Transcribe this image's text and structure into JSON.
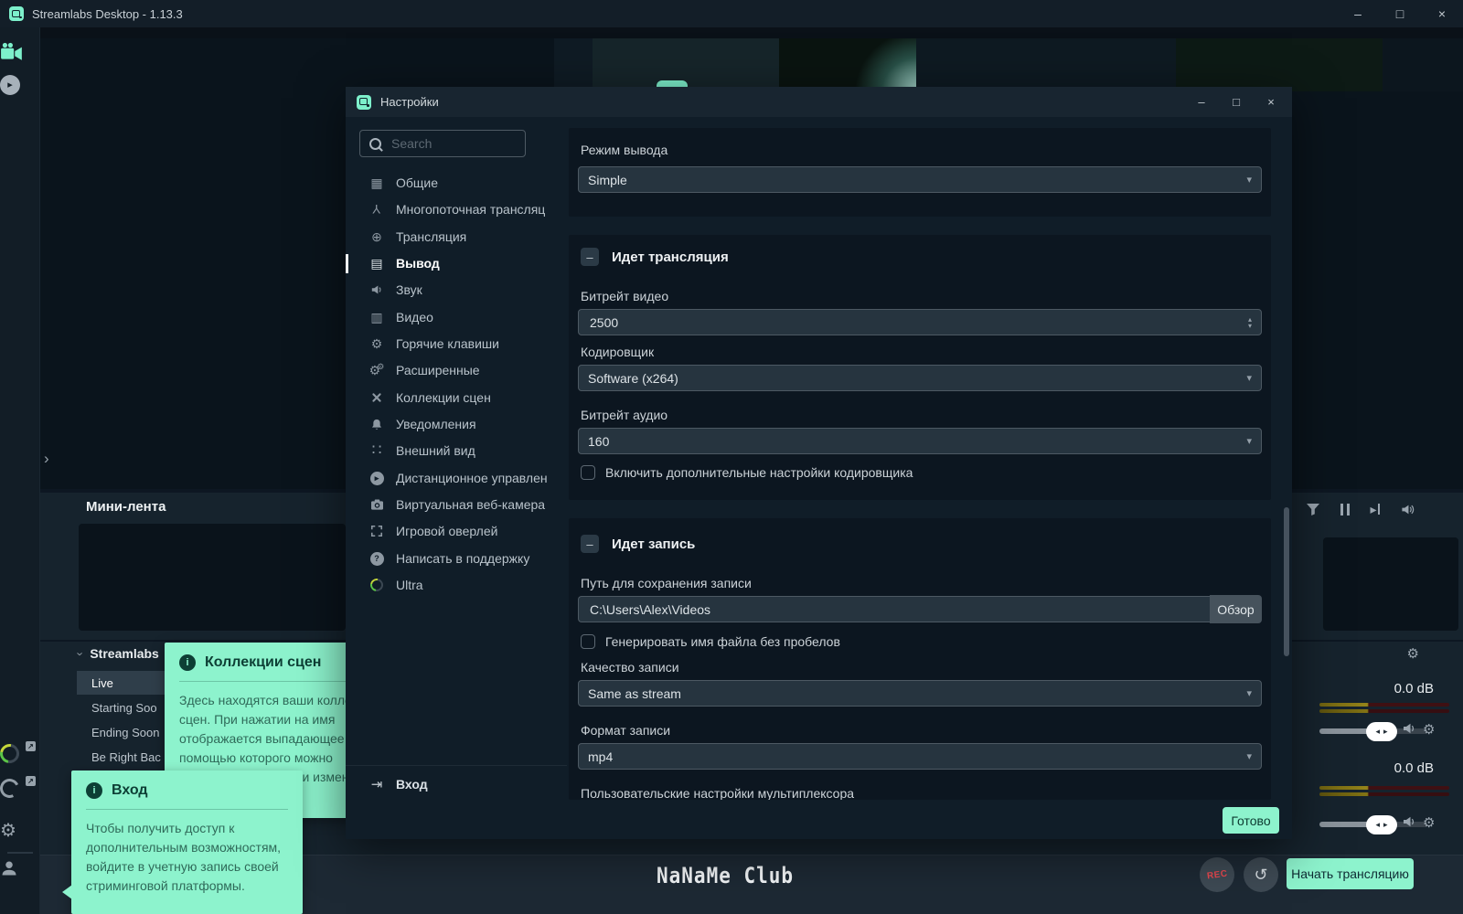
{
  "titlebar": {
    "title": "Streamlabs Desktop - 1.13.3"
  },
  "icons": {
    "minimize": "–",
    "maximize": "□",
    "close": "×",
    "chevron_down": "▾",
    "chevron_right": "›",
    "spin_up": "▴",
    "spin_down": "▾",
    "gear": "⚙",
    "globe": "⊕",
    "grid": "▦",
    "list": "▤",
    "film": "▥",
    "dots": "∷",
    "multistream": "Y",
    "play": "▸",
    "question": "?",
    "info": "i",
    "login": "⇥",
    "external": "↗",
    "undo": "↺",
    "minus": "–",
    "handle_left": "◂",
    "handle_right": "▸"
  },
  "colors": {
    "accent_mint": "#8df3cd",
    "accent_teal": "#7df0cb",
    "rec_red": "#e8484f"
  },
  "dialog": {
    "title": "Настройки",
    "search_placeholder": "Search",
    "menu": [
      {
        "label": "Общие"
      },
      {
        "label": "Многопоточная трансляц"
      },
      {
        "label": "Трансляция"
      },
      {
        "label": "Вывод"
      },
      {
        "label": "Звук"
      },
      {
        "label": "Видео"
      },
      {
        "label": "Горячие клавиши"
      },
      {
        "label": "Расширенные"
      },
      {
        "label": "Коллекции сцен"
      },
      {
        "label": "Уведомления"
      },
      {
        "label": "Внешний вид"
      },
      {
        "label": "Дистанционное управлен"
      },
      {
        "label": "Виртуальная веб-камера"
      },
      {
        "label": "Игровой оверлей"
      },
      {
        "label": "Написать в поддержку"
      },
      {
        "label": "Ultra"
      }
    ],
    "login_label": "Вход",
    "output_mode": {
      "label": "Режим вывода",
      "value": "Simple"
    },
    "streaming": {
      "title": "Идет трансляция",
      "video_bitrate": {
        "label": "Битрейт видео",
        "value": "2500"
      },
      "encoder": {
        "label": "Кодировщик",
        "value": "Software (x264)"
      },
      "audio_bitrate": {
        "label": "Битрейт аудио",
        "value": "160"
      },
      "advanced_checkbox": "Включить дополнительные настройки кодировщика"
    },
    "recording": {
      "title": "Идет запись",
      "path": {
        "label": "Путь для сохранения записи",
        "value": "C:\\Users\\Alex\\Videos",
        "browse": "Обзор"
      },
      "filename_checkbox": "Генерировать имя файла без пробелов",
      "quality": {
        "label": "Качество записи",
        "value": "Same as stream"
      },
      "format": {
        "label": "Формат записи",
        "value": "mp4"
      },
      "muxer_label": "Пользовательские настройки мультиплексора"
    },
    "done_button": "Готово"
  },
  "main": {
    "minifeed_title": "Мини-лента",
    "scenes": {
      "header": "Streamlabs",
      "items": [
        "Live",
        "Starting Soo",
        "Ending Soon",
        "Be Right Bac"
      ]
    },
    "mixer": {
      "channels": [
        {
          "db": "0.0 dB"
        },
        {
          "db": "0.0 dB"
        }
      ]
    },
    "watermark": "NaNaMe Club",
    "rec_button": "REC",
    "go_live_button": "Начать трансляцию"
  },
  "tooltips": {
    "scene_collections": {
      "title": "Коллекции сцен",
      "body": "Здесь находятся ваши коллекции сцен. При нажатии на имя отображается выпадающее меню, с помощью которого можно просмотреть и внести изменения в сцену."
    },
    "login": {
      "title": "Вход",
      "body": "Чтобы получить доступ к дополнительным возможностям, войдите в учетную запись своей стриминговой платформы."
    }
  }
}
